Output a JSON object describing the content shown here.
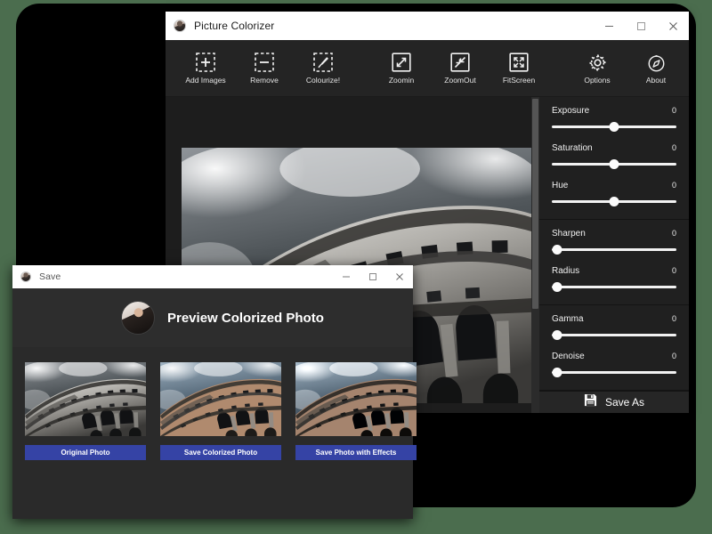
{
  "theme": {
    "desktop_background": "#4b6d4e",
    "window_chrome": "#ffffff",
    "panel_dark": "#202020",
    "accent_blue": "#3543a5",
    "slider_track": "#f2f2f2"
  },
  "main_window": {
    "title": "Picture Colorizer",
    "app_icon": "app-avatar-icon",
    "window_controls": [
      {
        "name": "minimize",
        "glyph": "minimize-icon"
      },
      {
        "name": "maximize",
        "glyph": "maximize-icon"
      },
      {
        "name": "close",
        "glyph": "close-icon"
      }
    ],
    "toolbar": [
      {
        "label": "Add Images",
        "icon": "add-images-icon"
      },
      {
        "label": "Remove",
        "icon": "remove-icon"
      },
      {
        "label": "Colourize!",
        "icon": "colourize-brush-icon"
      },
      {
        "label": "Zoomin",
        "icon": "zoom-in-icon"
      },
      {
        "label": "ZoomOut",
        "icon": "zoom-out-icon"
      },
      {
        "label": "FitScreen",
        "icon": "fit-screen-icon"
      },
      {
        "label": "Options",
        "icon": "gear-icon"
      },
      {
        "label": "About",
        "icon": "compass-icon"
      }
    ],
    "canvas": {
      "image_alt": "black-and-white-colosseum-photo"
    },
    "adjust_panel": {
      "groups": [
        {
          "sliders": [
            {
              "label": "Exposure",
              "value": "0",
              "position": 50
            },
            {
              "label": "Saturation",
              "value": "0",
              "position": 50
            },
            {
              "label": "Hue",
              "value": "0",
              "position": 50
            }
          ]
        },
        {
          "sliders": [
            {
              "label": "Sharpen",
              "value": "0",
              "position": 3
            },
            {
              "label": "Radius",
              "value": "0",
              "position": 3
            }
          ]
        },
        {
          "sliders": [
            {
              "label": "Gamma",
              "value": "0",
              "position": 3
            },
            {
              "label": "Denoise",
              "value": "0",
              "position": 3
            }
          ]
        }
      ],
      "save_as_label": "Save As",
      "save_as_icon": "floppy-disk-icon"
    }
  },
  "save_dialog": {
    "title": "Save",
    "app_icon": "app-avatar-icon",
    "window_controls": [
      {
        "name": "minimize",
        "glyph": "minimize-icon"
      },
      {
        "name": "maximize",
        "glyph": "maximize-icon"
      },
      {
        "name": "close",
        "glyph": "close-icon"
      }
    ],
    "header_title": "Preview Colorized Photo",
    "header_avatar": "avatar",
    "thumbnails": [
      {
        "button_label": "Original Photo",
        "image_alt": "original-grayscale-colosseum",
        "tint": "none"
      },
      {
        "button_label": "Save Colorized Photo",
        "image_alt": "colorized-colosseum",
        "tint": "warm"
      },
      {
        "button_label": "Save Photo with Effects",
        "image_alt": "colosseum-with-effects",
        "tint": "warm-contrast"
      }
    ]
  }
}
